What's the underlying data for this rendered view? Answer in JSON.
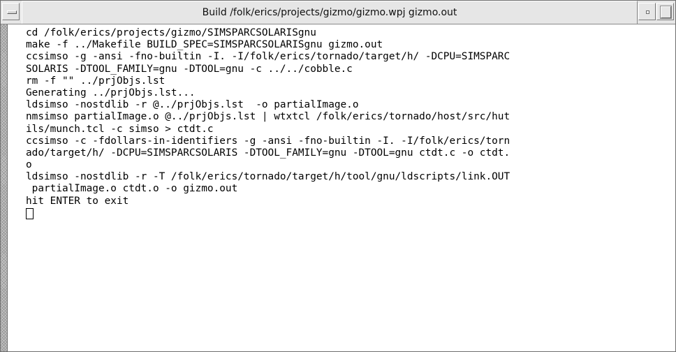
{
  "window": {
    "title": "Build /folk/erics/projects/gizmo/gizmo.wpj gizmo.out"
  },
  "terminal": {
    "lines": [
      "cd /folk/erics/projects/gizmo/SIMSPARCSOLARISgnu",
      "make -f ../Makefile BUILD_SPEC=SIMSPARCSOLARISgnu gizmo.out",
      "ccsimso -g -ansi -fno-builtin -I. -I/folk/erics/tornado/target/h/ -DCPU=SIMSPARC",
      "SOLARIS -DTOOL_FAMILY=gnu -DTOOL=gnu -c ../../cobble.c",
      "rm -f \"\" ../prjObjs.lst",
      "Generating ../prjObjs.lst...",
      "ldsimso -nostdlib -r @../prjObjs.lst  -o partialImage.o",
      "nmsimso partialImage.o @../prjObjs.lst | wtxtcl /folk/erics/tornado/host/src/hut",
      "ils/munch.tcl -c simso > ctdt.c",
      "ccsimso -c -fdollars-in-identifiers -g -ansi -fno-builtin -I. -I/folk/erics/torn",
      "ado/target/h/ -DCPU=SIMSPARCSOLARIS -DTOOL_FAMILY=gnu -DTOOL=gnu ctdt.c -o ctdt.",
      "o",
      "ldsimso -nostdlib -r -T /folk/erics/tornado/target/h/tool/gnu/ldscripts/link.OUT",
      " partialImage.o ctdt.o -o gizmo.out",
      "hit ENTER to exit"
    ]
  },
  "icons": {
    "window_menu": "window-menu-icon",
    "minimize": "minimize-icon",
    "maximize": "maximize-icon",
    "cursor": "text-cursor-icon"
  }
}
